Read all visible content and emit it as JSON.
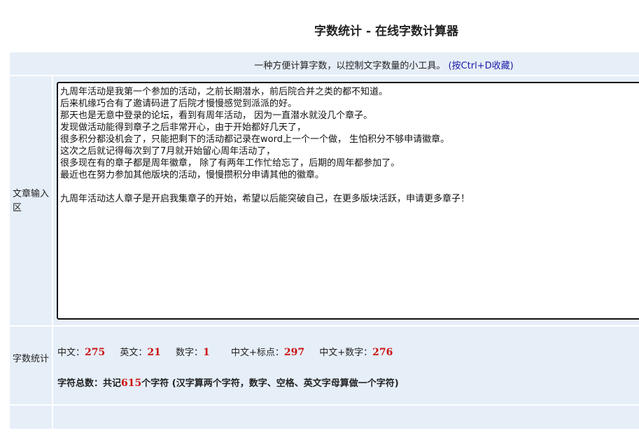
{
  "page": {
    "title": "字数统计 - 在线字数计算器",
    "subtitle": "一种方便计算字数，以控制文字数量的小工具。",
    "hint": "(按Ctrl+D收藏)"
  },
  "input_section": {
    "label": "文章输入区",
    "text": "九周年活动是我第一个参加的活动，之前长期潜水，前后院合并之类的都不知道。\n后来机缘巧合有了邀请码进了后院才慢慢感觉到派派的好。\n那天也是无意中登录的论坛，看到有周年活动， 因为一直潜水就没几个章子。\n发现做活动能得到章子之后非常开心，由于开始都好几天了，\n很多积分都没机会了，只能把剩下的活动都记录在word上一个一个做， 生怕积分不够申请徽章。\n这次之后就记得每次到了7月就开始留心周年活动了，\n很多现在有的章子都是周年徽章， 除了有两年工作忙给忘了，后期的周年都参加了。\n最近也在努力参加其他版块的活动，慢慢攒积分申请其他的徽章。\n\n九周年活动达人章子是开启我集章子的开始，希望以后能突破自己，在更多版块活跃，申请更多章子！"
  },
  "stats_section": {
    "label": "字数统计",
    "items": [
      {
        "label": "中文：",
        "value": "275"
      },
      {
        "label": "英文：",
        "value": "21"
      },
      {
        "label": "数字：",
        "value": "1"
      },
      {
        "label": "中文+标点：",
        "value": "297"
      },
      {
        "label": "中文+数字：",
        "value": "276"
      }
    ],
    "total": {
      "prefix": "字符总数：共记",
      "value": "615",
      "suffix": "个字符 (汉字算两个字符，数字、空格、英文字母算做一个字符)"
    }
  },
  "colors": {
    "panel_bg": "#e6eef8",
    "value_red": "#cc1111",
    "hint_blue": "#1a1aa6"
  }
}
